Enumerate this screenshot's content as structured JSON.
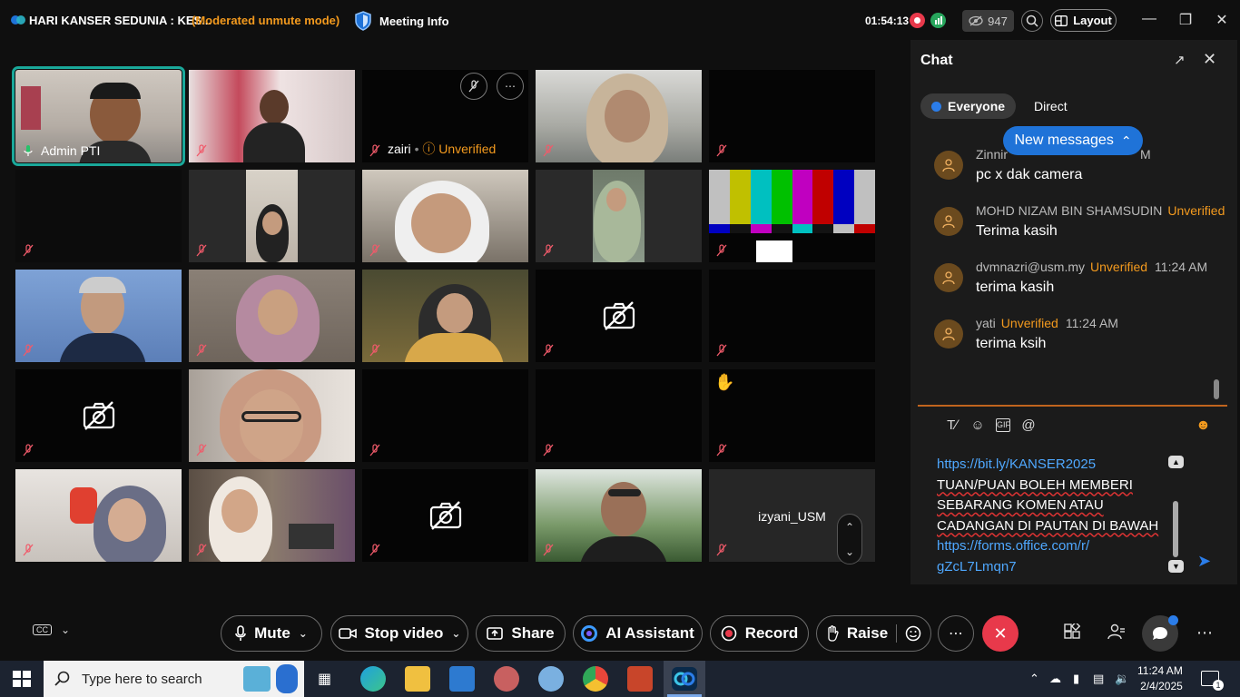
{
  "titlebar": {
    "meeting_title": "HARI KANSER SEDUNIA : KES...",
    "mode": "(Moderated unmute mode)",
    "meeting_info": "Meeting Info",
    "timer": "01:54:13",
    "participant_count": "947",
    "layout": "Layout"
  },
  "tiles": [
    {
      "name": "Admin PTI",
      "unverified": ""
    },
    {
      "name": "",
      "unverified": ""
    },
    {
      "name": "zairi",
      "unverified": "Unverified"
    },
    {
      "name": "",
      "unverified": ""
    },
    {
      "name": "",
      "unverified": ""
    },
    {
      "name": "izyani_USM",
      "unverified": ""
    }
  ],
  "chat": {
    "title": "Chat",
    "tab_everyone": "Everyone",
    "tab_direct": "Direct",
    "new_messages": "New messages",
    "messages": [
      {
        "sender": "Zinnir",
        "unverified": "",
        "time": "M",
        "text": "pc x dak camera"
      },
      {
        "sender": "MOHD NIZAM BIN SHAMSUDIN",
        "unverified": "Unverified",
        "time": "",
        "text": "Terima kasih"
      },
      {
        "sender": "dvmnazri@usm.my",
        "unverified": "Unverified",
        "time": "11:24 AM",
        "text": "terima kasih"
      },
      {
        "sender": "yati",
        "unverified": "Unverified",
        "time": "11:24 AM",
        "text": "terima ksih"
      }
    ],
    "compose": {
      "link1": "https://bit.ly/KANSER2025",
      "line1": "TUAN/PUAN BOLEH MEMBERI",
      "line2": "SEBARANG KOMEN ATAU",
      "line3": "CADANGAN DI PAUTAN DI BAWAH",
      "link2a": "https://forms.office.com/r/",
      "link2b": "gZcL7Lmqn7"
    }
  },
  "controls": {
    "mute": "Mute",
    "stop_video": "Stop video",
    "share": "Share",
    "ai_assistant": "AI Assistant",
    "record": "Record",
    "raise": "Raise"
  },
  "taskbar": {
    "search_placeholder": "Type here to search",
    "time": "11:24 AM",
    "date": "2/4/2025",
    "notification_count": "1"
  },
  "colors": {
    "accent_blue": "#1f73d8",
    "unverified_orange": "#f39a1e",
    "leave_red": "#e8394b",
    "active_speaker_teal": "#1aa89a"
  }
}
